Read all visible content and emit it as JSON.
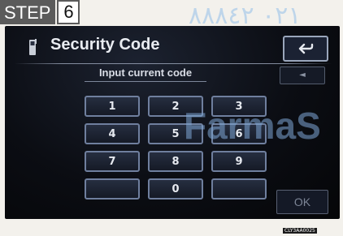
{
  "step": {
    "word": "STEP",
    "number": "6"
  },
  "watermark": {
    "top": "٠٢١ ٨٨٨٤٢",
    "middle": "FarmaS"
  },
  "screen": {
    "title": "Security Code",
    "prompt": "Input current code",
    "delete_label": "◄",
    "keypad": [
      "1",
      "2",
      "3",
      "4",
      "5",
      "6",
      "7",
      "8",
      "9",
      "",
      "0",
      ""
    ],
    "ok_label": "OK"
  },
  "figure_code": "CLY3AA0025"
}
